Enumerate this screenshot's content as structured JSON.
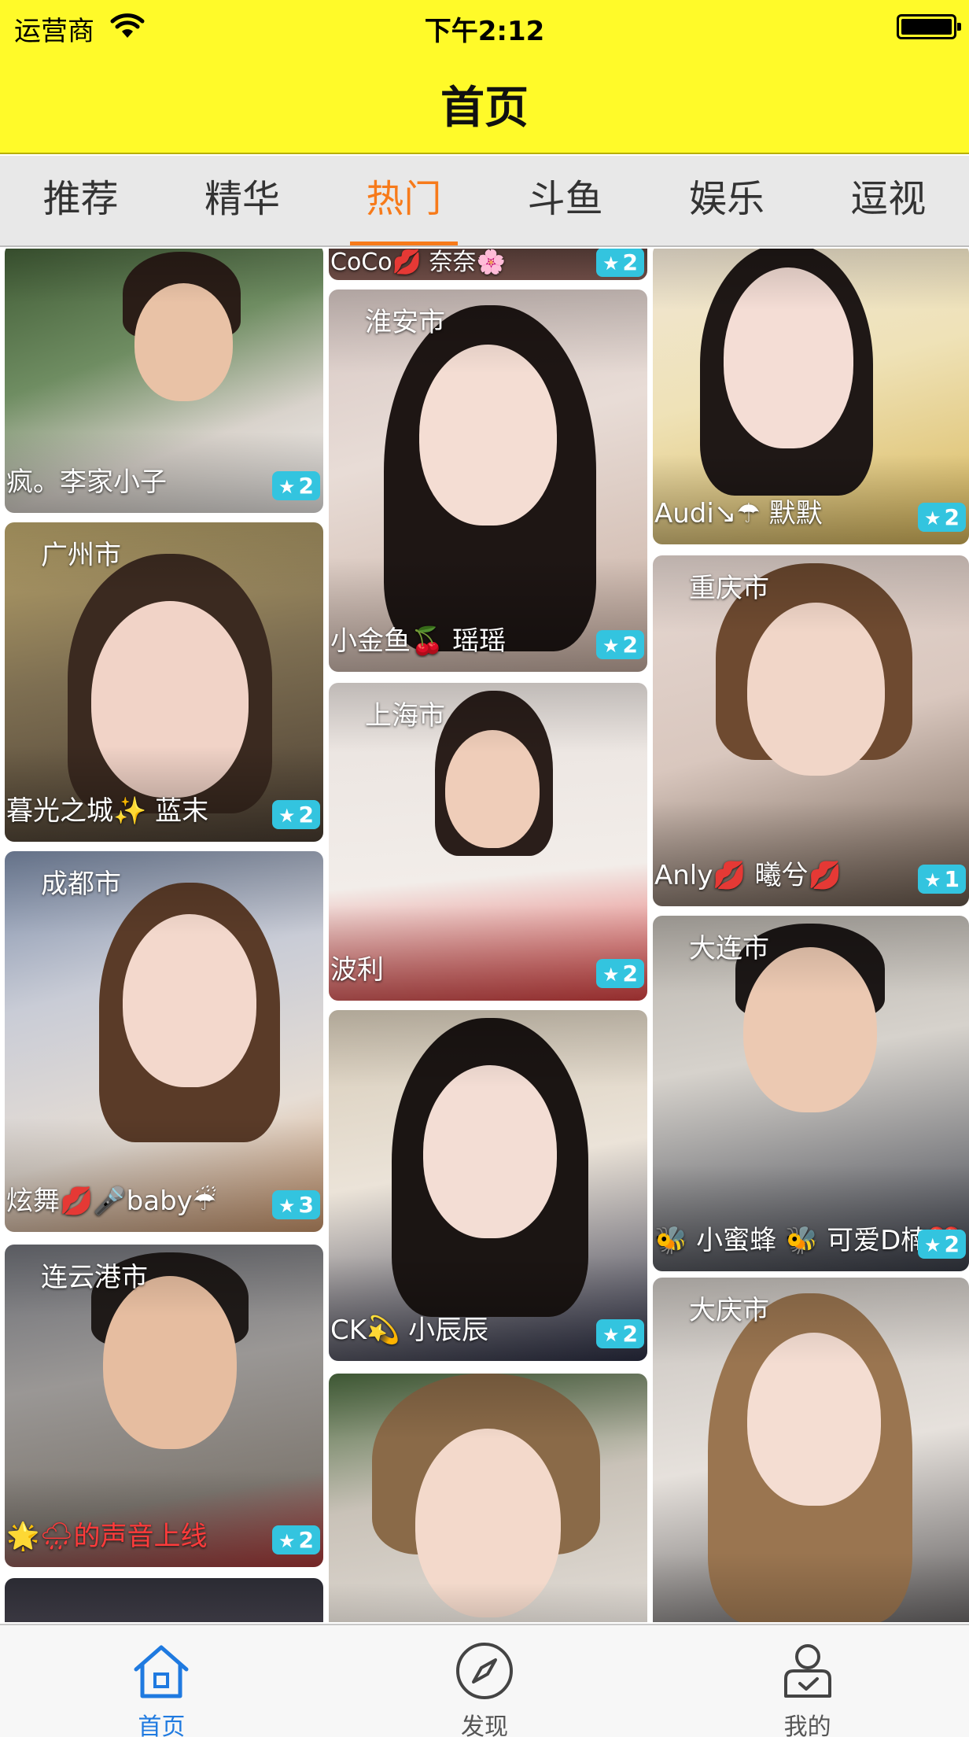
{
  "status_bar": {
    "carrier": "运营商",
    "time": "下午2:12"
  },
  "nav": {
    "title": "首页"
  },
  "category_tabs": [
    {
      "label": "推荐"
    },
    {
      "label": "精华"
    },
    {
      "label": "热门",
      "active": true
    },
    {
      "label": "斗鱼"
    },
    {
      "label": "娱乐"
    },
    {
      "label": "逗视"
    }
  ],
  "feed": {
    "columns": [
      [
        {
          "city": "",
          "name": "疯。李家小子",
          "badge": "2"
        },
        {
          "city": "广州市",
          "name": "暮光之城✨ 蓝末",
          "badge": "2"
        },
        {
          "city": "成都市",
          "name": "炫舞💋🎤baby☔",
          "badge": "3"
        },
        {
          "city": "连云港市",
          "name": "🌟🌧的声音上线",
          "badge": "2"
        },
        {
          "city": "",
          "name": "",
          "badge": ""
        }
      ],
      [
        {
          "city": "",
          "name": "CoCo💋 奈奈🌸",
          "badge": "2"
        },
        {
          "city": "淮安市",
          "name": "小金鱼🍒 瑶瑶",
          "badge": "2"
        },
        {
          "city": "上海市",
          "name": "波利",
          "badge": "2"
        },
        {
          "city": "",
          "name": "CK💫 小辰辰",
          "badge": "2"
        },
        {
          "city": "",
          "name": "",
          "badge": ""
        }
      ],
      [
        {
          "city": "",
          "name": "Audi↘☂ 默默",
          "badge": "2"
        },
        {
          "city": "重庆市",
          "name": "Anly💋 曦兮💋",
          "badge": "1"
        },
        {
          "city": "大连市",
          "name": "🐝 小蜜蜂 🐝 可爱D楠❤️",
          "badge": "2"
        },
        {
          "city": "大庆市",
          "name": "",
          "badge": ""
        }
      ]
    ]
  },
  "tab_bar": [
    {
      "label": "首页",
      "icon": "home-icon",
      "active": true
    },
    {
      "label": "发现",
      "icon": "compass-icon"
    },
    {
      "label": "我的",
      "icon": "profile-icon"
    }
  ],
  "colors": {
    "header_yellow": "#fffa29",
    "tab_active_orange": "#f77a1a",
    "badge_cyan": "#33c4df",
    "tabbar_active_blue": "#1f7ae0"
  }
}
